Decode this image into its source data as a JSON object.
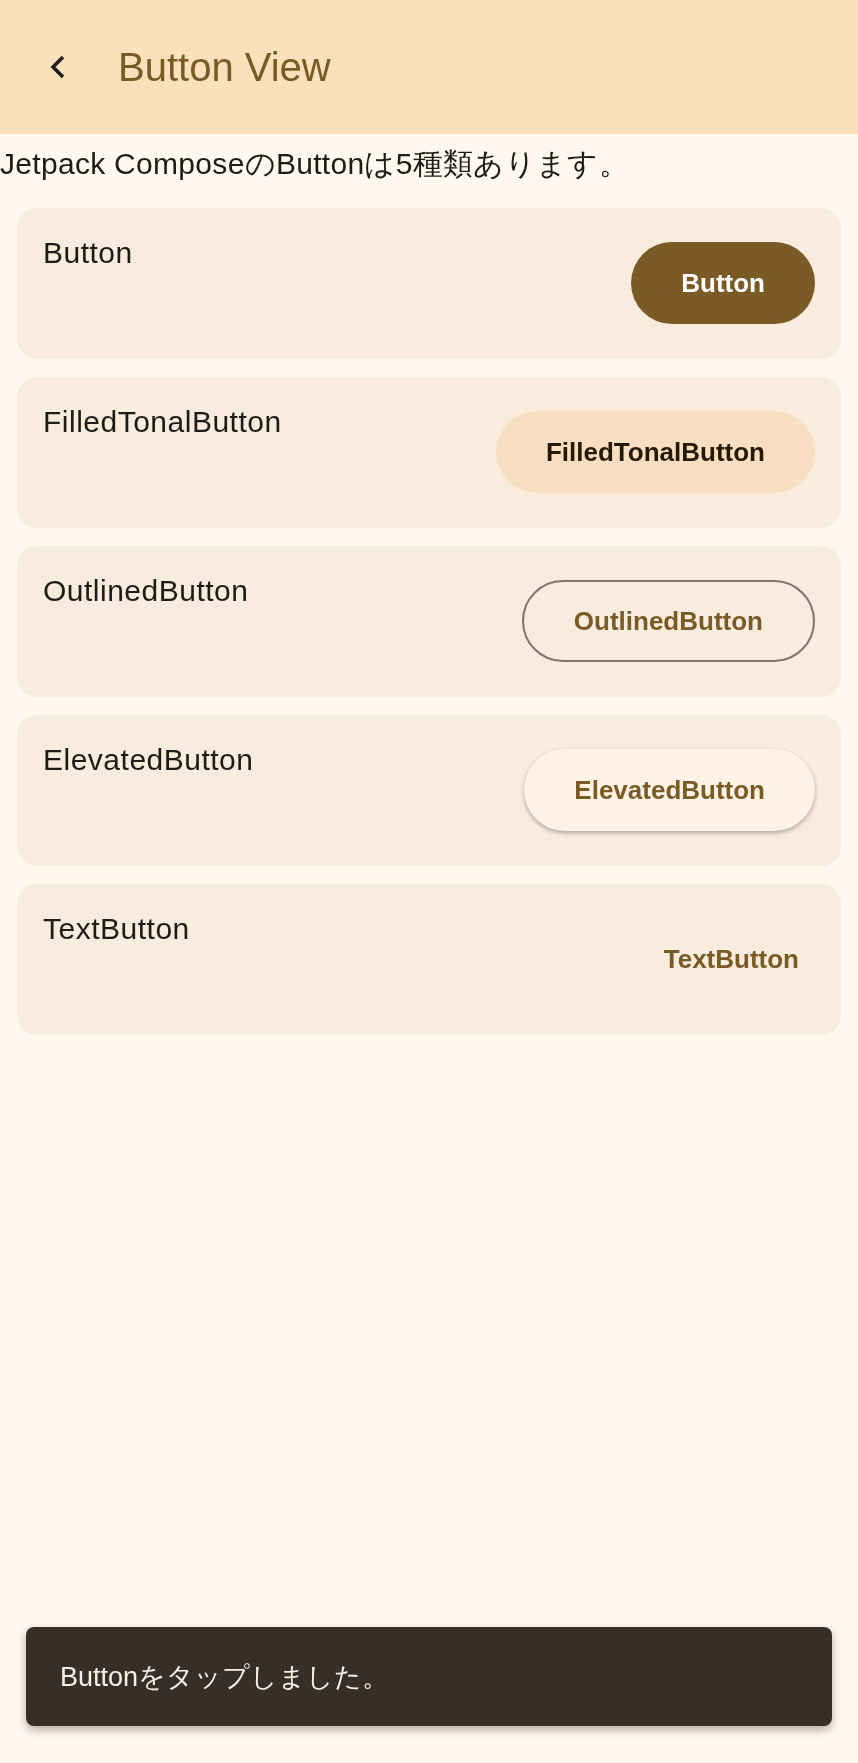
{
  "app_bar": {
    "title": "Button View"
  },
  "description": "Jetpack ComposeのButtonは5種類あります。",
  "cards": [
    {
      "label": "Button",
      "button": {
        "kind": "filled",
        "text": "Button"
      }
    },
    {
      "label": "FilledTonalButton",
      "button": {
        "kind": "tonal",
        "text": "FilledTonalButton"
      }
    },
    {
      "label": "OutlinedButton",
      "button": {
        "kind": "outlined",
        "text": "OutlinedButton"
      }
    },
    {
      "label": "ElevatedButton",
      "button": {
        "kind": "elevated",
        "text": "ElevatedButton"
      }
    },
    {
      "label": "TextButton",
      "button": {
        "kind": "text",
        "text": "TextButton"
      }
    }
  ],
  "snackbar": {
    "message": "Buttonをタップしました。"
  }
}
